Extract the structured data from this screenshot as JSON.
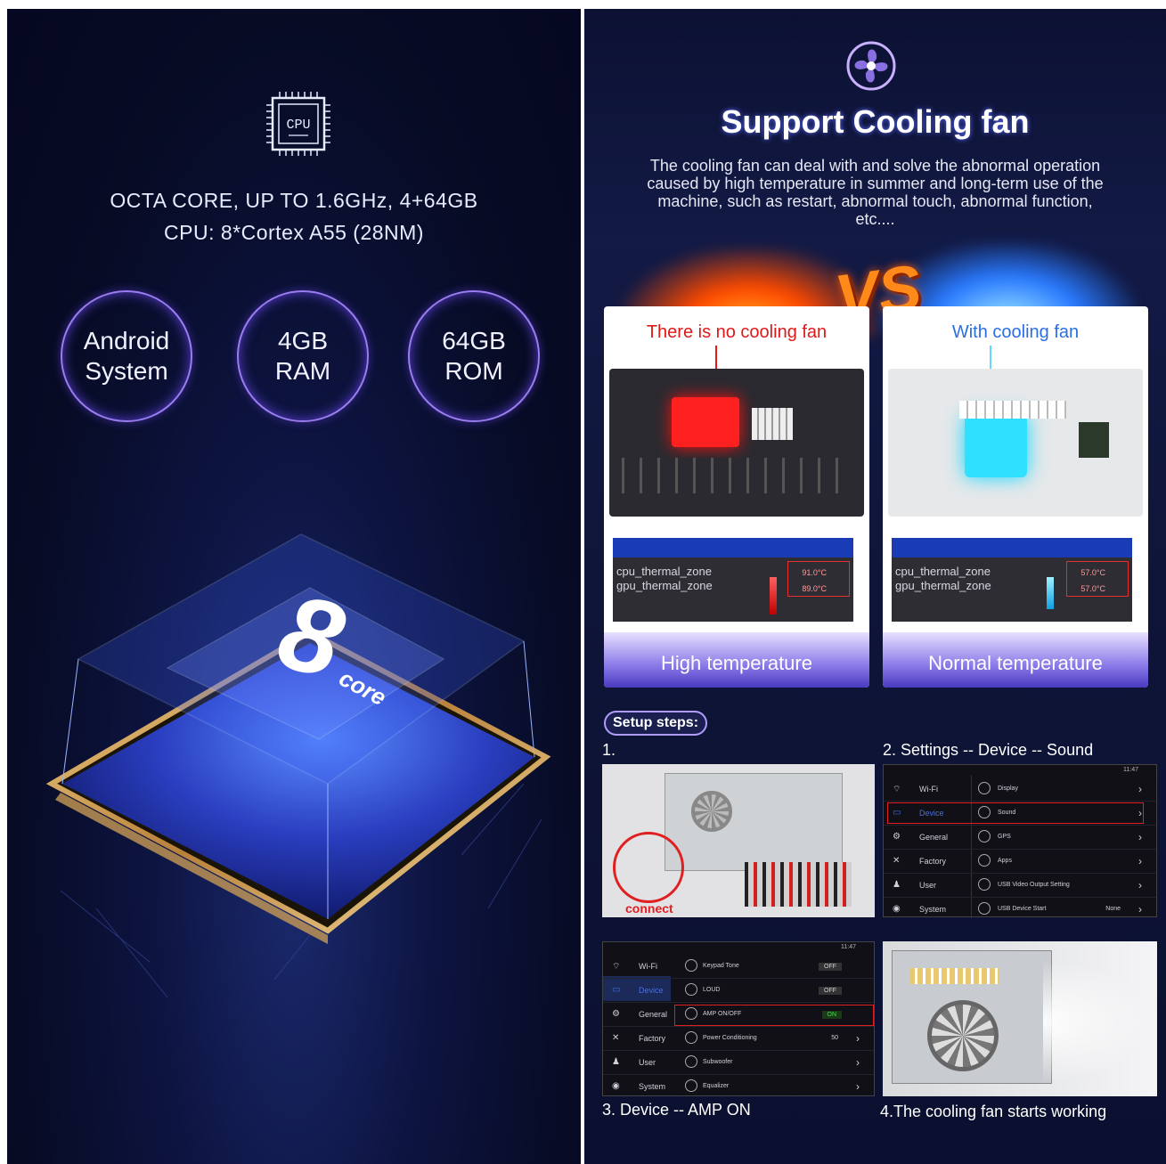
{
  "left": {
    "cpu_icon_label": "CPU",
    "spec_line1": "OCTA CORE, UP TO 1.6GHz, 4+64GB",
    "spec_line2": "CPU: 8*Cortex  A55 (28NM)",
    "badges": [
      {
        "line1": "Android",
        "line2": "System"
      },
      {
        "line1": "4GB",
        "line2": "RAM"
      },
      {
        "line1": "64GB",
        "line2": "ROM"
      }
    ],
    "chip_number": "8",
    "chip_word": "core"
  },
  "right": {
    "title": "Support Cooling fan",
    "description": "The cooling fan can deal with and solve the abnormal operation caused by high temperature in summer and long-term use of the machine, such as restart, abnormal touch, abnormal function, etc....",
    "vs": "VS",
    "cards": [
      {
        "heading": "There is no cooling fan",
        "zone1": "cpu_thermal_zone",
        "zone2": "gpu_thermal_zone",
        "temp1": "91.0°C",
        "temp2": "89.0°C",
        "footer": "High temperature"
      },
      {
        "heading": "With cooling fan",
        "zone1": "cpu_thermal_zone",
        "zone2": "gpu_thermal_zone",
        "temp1": "57.0°C",
        "temp2": "57.0°C",
        "footer": "Normal temperature"
      }
    ],
    "setup_title": "Setup steps:",
    "step1": "1.",
    "step1_caption": "connect",
    "step2": "2. Settings -- Device -- Sound",
    "step3": "3. Device -- AMP ON",
    "step4": "4.The cooling fan starts working",
    "settings_menu": {
      "status": "11:47",
      "left_items": [
        "Wi-Fi",
        "Device",
        "General",
        "Factory",
        "User",
        "System"
      ],
      "device_items": [
        "Display",
        "Sound",
        "GPS",
        "Apps",
        "USB Video Output Setting",
        "USB Device Start"
      ],
      "device_last_value": "None"
    },
    "sound_menu": {
      "status": "11:47",
      "left_items": [
        "Wi-Fi",
        "Device",
        "General",
        "Factory",
        "User",
        "System"
      ],
      "items": [
        "Keypad Tone",
        "LOUD",
        "AMP ON/OFF",
        "Power Conditioning",
        "Subwoofer",
        "Equalizer"
      ],
      "values": [
        "OFF",
        "OFF",
        "ON",
        "50",
        "",
        ""
      ]
    }
  }
}
